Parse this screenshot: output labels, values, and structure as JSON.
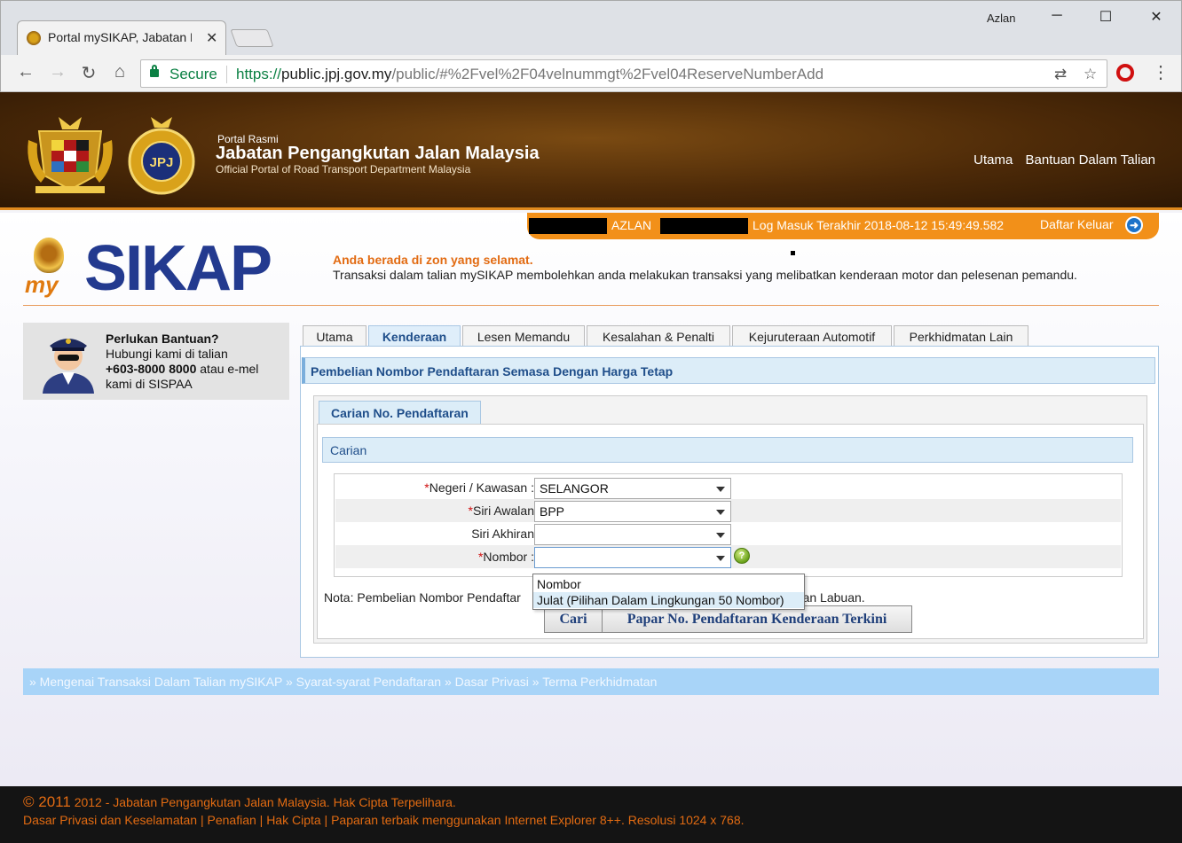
{
  "browser": {
    "tab_title": "Portal mySIKAP, Jabatan P",
    "tab_close": "✕",
    "user": "Azlan",
    "win_minimize": "─",
    "win_maximize": "☐",
    "win_close": "✕",
    "nav_back": "←",
    "nav_forward": "→",
    "nav_reload": "↻",
    "nav_home": "⌂",
    "secure_label": "Secure",
    "url_scheme": "https://",
    "url_domain": "public.jpj.gov.my",
    "url_path": "/public/#%2Fvel%2F04velnummgt%2Fvel04ReserveNumberAdd",
    "translate_icon": "⇄",
    "bookmark_icon": "☆",
    "menu_icon": "⋮"
  },
  "header": {
    "portal_small": "Portal Rasmi",
    "portal_title": "Jabatan Pengangkutan Jalan Malaysia",
    "portal_subtitle": "Official Portal of Road Transport Department Malaysia",
    "links": [
      "Utama",
      "Bantuan Dalam Talian"
    ],
    "jpj_mark": "JPJ"
  },
  "userbar": {
    "username": "AZLAN",
    "last_login": "Log Masuk Terakhir 2018-08-12 15:49:49.582",
    "logout": "Daftar Keluar",
    "logout_icon": "➜"
  },
  "brand": {
    "logo_my": "my",
    "logo_sikap": "SIKAP",
    "safe_zone": "Anda berada di zon yang selamat.",
    "intro": "Transaksi dalam talian mySIKAP membolehkan anda melakukan transaksi yang melibatkan kenderaan motor dan pelesenan pemandu."
  },
  "help": {
    "title": "Perlukan Bantuan?",
    "line1": "Hubungi kami di talian",
    "phone": "+603-8000 8000",
    "line2_rest": " atau e-mel",
    "line3": "kami di SISPAA"
  },
  "tabs": [
    "Utama",
    "Kenderaan",
    "Lesen Memandu",
    "Kesalahan & Penalti",
    "Kejuruteraan Automotif",
    "Perkhidmatan Lain"
  ],
  "active_tab": "Kenderaan",
  "content": {
    "title": "Pembelian Nombor Pendaftaran Semasa Dengan Harga Tetap",
    "subtab": "Carian No. Pendaftaran",
    "section": "Carian",
    "fields": [
      {
        "required": "*",
        "label": "Negeri / Kawasan :",
        "value": "SELANGOR"
      },
      {
        "required": "*",
        "label": "Siri Awalan",
        "value": "BPP"
      },
      {
        "required": "",
        "label": "Siri Akhiran",
        "value": ""
      },
      {
        "required": "*",
        "label": "Nombor :",
        "value": ""
      }
    ],
    "help_q": "?",
    "nota_start": "Nota: Pembelian Nombor Pendaftar",
    "nota_end": "i dan Labuan.",
    "btn_search": "Cari",
    "btn_view": "Papar No. Pendaftaran Kenderaan Terkini",
    "dropdown_options": [
      "Nombor",
      "Julat (Pilihan Dalam Lingkungan 50 Nombor)"
    ],
    "dropdown_highlight": "Julat (Pilihan Dalam Lingkungan 50 Nombor)"
  },
  "footer_links": [
    "» Mengenai Transaksi Dalam Talian mySIKAP",
    "» Syarat-syarat Pendaftaran",
    "» Dasar Privasi",
    "» Terma Perkhidmatan"
  ],
  "footer": {
    "copy_year": "© 2011",
    "copy_rest": " 2012 - Jabatan Pengangkutan Jalan Malaysia. Hak Cipta Terpelihara.",
    "legal": "Dasar Privasi dan Keselamatan | Penafian | Hak Cipta | Paparan terbaik menggunakan Internet Explorer 8++. Resolusi 1024 x 768."
  },
  "colors": {
    "accent_orange": "#f29019",
    "brand_blue": "#233a8f",
    "panel_blue": "#dcedf8"
  }
}
